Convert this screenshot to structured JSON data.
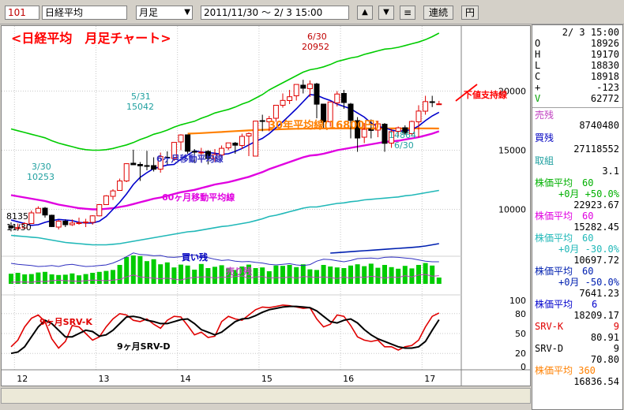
{
  "toolbar": {
    "code": "101",
    "name": "日経平均",
    "period": "月足",
    "dropdown_arrow": "▼",
    "range": "2011/11/30 ～ 2/ 3 15:00",
    "up": "▲",
    "down": "▼",
    "menu": "≡",
    "renzoku": "連続",
    "yen": "円"
  },
  "chart": {
    "title": "<日経平均　月足チャート>",
    "annotations": {
      "high_date": "6/30",
      "high_value": "20952",
      "may_date": "5/31",
      "may_value": "15042",
      "march_date": "3/30",
      "march_value": "10253",
      "start_value": "8135",
      "start_date": "11/30",
      "low_value": "14864",
      "low_date": "6/30",
      "ma30": "30年平均線(16800円)",
      "ma6": "6ヶ月移動平均線",
      "ma60": "60ヶ月移動平均線",
      "support": "下値支持線",
      "buy": "買い残",
      "sell": "売り残",
      "srv_k": "9ヶ月SRV-K",
      "srv_d": "9ヶ月SRV-D"
    },
    "y_ticks": [
      "20000",
      "15000",
      "10000"
    ],
    "osc_ticks": [
      "100",
      "80",
      "50",
      "20",
      "0"
    ],
    "x_ticks": [
      "12",
      "13",
      "14",
      "15",
      "16",
      "17"
    ],
    "colors": {
      "up": "#e00000",
      "down": "#000000",
      "ma6": "#0000cc",
      "ma60": "#e000e0",
      "ma360": "#ff8000",
      "green": "#00cc00",
      "teal": "#20b8b8",
      "navy": "#0020b0",
      "srvk": "#e00000",
      "srvd": "#000000"
    }
  },
  "panel": {
    "datetime": "2/ 3 15:00",
    "ohlc": [
      {
        "k": "O",
        "v": "18926"
      },
      {
        "k": "H",
        "v": "19170"
      },
      {
        "k": "L",
        "v": "18830"
      },
      {
        "k": "C",
        "v": "18918"
      },
      {
        "k": "+",
        "v": "-123"
      },
      {
        "k": "V",
        "v": "62772"
      }
    ],
    "urizan_label": "売残",
    "urizan_value": "8740480",
    "kaizan_label": "買残",
    "kaizan_value": "27118552",
    "torikumi_label": "取組",
    "torikumi_value": "3.1",
    "ma_a_label": "株価平均　60",
    "ma_a_sub": "+0月 +50.0%",
    "ma_a_value": "22923.67",
    "ma_b_label": "株価平均　60",
    "ma_b_value": "15282.45",
    "ma_c_label": "株価平均　60",
    "ma_c_sub": "+0月 -30.0%",
    "ma_c_value": "10697.72",
    "ma_d_label": "株価平均　60",
    "ma_d_sub": "+0月 -50.0%",
    "ma_d_value": "7641.23",
    "ma_e_label": "株価平均　　6",
    "ma_e_value": "18209.17",
    "srvk_label": "SRV-K",
    "srvk_n": "9",
    "srvk_value": "80.91",
    "srvd_label": "SRV-D",
    "srvd_n": "9",
    "srvd_value": "70.80",
    "ma_f_label": "株価平均 360",
    "ma_f_value": "16836.54"
  },
  "chart_data": {
    "type": "candlestick",
    "x": [
      "2011-11",
      "2011-12",
      "2012-01",
      "2012-02",
      "2012-03",
      "2012-04",
      "2012-05",
      "2012-06",
      "2012-07",
      "2012-08",
      "2012-09",
      "2012-10",
      "2012-11",
      "2012-12",
      "2013-01",
      "2013-02",
      "2013-03",
      "2013-04",
      "2013-05",
      "2013-06",
      "2013-07",
      "2013-08",
      "2013-09",
      "2013-10",
      "2013-11",
      "2013-12",
      "2014-01",
      "2014-02",
      "2014-03",
      "2014-04",
      "2014-05",
      "2014-06",
      "2014-07",
      "2014-08",
      "2014-09",
      "2014-10",
      "2014-11",
      "2014-12",
      "2015-01",
      "2015-02",
      "2015-03",
      "2015-04",
      "2015-05",
      "2015-06",
      "2015-07",
      "2015-08",
      "2015-09",
      "2015-10",
      "2015-11",
      "2015-12",
      "2016-01",
      "2016-02",
      "2016-03",
      "2016-04",
      "2016-05",
      "2016-06",
      "2016-07",
      "2016-08",
      "2016-09",
      "2016-10",
      "2016-11",
      "2016-12",
      "2017-01",
      "2017-02"
    ],
    "open": [
      8600,
      8440,
      8430,
      8800,
      9700,
      10100,
      9500,
      8500,
      9000,
      8700,
      8800,
      8900,
      8900,
      9450,
      10400,
      11100,
      11600,
      12400,
      13900,
      13800,
      13700,
      13700,
      13400,
      14400,
      14300,
      15700,
      16300,
      14900,
      14800,
      14900,
      14300,
      14600,
      15200,
      15600,
      15400,
      16200,
      14500,
      17500,
      17400,
      17700,
      18800,
      19200,
      19600,
      20500,
      20200,
      20600,
      18900,
      17400,
      19000,
      19800,
      18900,
      17500,
      16100,
      16800,
      16700,
      17200,
      15600,
      16600,
      16900,
      16400,
      17400,
      18300,
      19100,
      18900
    ],
    "high": [
      8900,
      8800,
      8900,
      9900,
      10255,
      10200,
      9550,
      9100,
      9150,
      9150,
      9300,
      9200,
      9500,
      10450,
      11200,
      11700,
      12600,
      13900,
      15042,
      14000,
      14950,
      14400,
      14800,
      14900,
      15600,
      16350,
      16200,
      15100,
      15200,
      15000,
      15100,
      15400,
      15600,
      15700,
      16400,
      16500,
      17500,
      18000,
      17900,
      18800,
      19800,
      20100,
      20500,
      20952,
      20900,
      20700,
      18900,
      19000,
      20000,
      20100,
      19000,
      17800,
      17300,
      17600,
      17500,
      17300,
      16800,
      17000,
      17100,
      17500,
      18800,
      19600,
      19600,
      19170
    ],
    "low": [
      8135,
      8200,
      8350,
      8800,
      9700,
      9300,
      8500,
      8300,
      8500,
      8600,
      8700,
      8500,
      8700,
      9400,
      10400,
      10800,
      11600,
      12300,
      13800,
      12400,
      13300,
      13200,
      13100,
      13800,
      14100,
      15000,
      14700,
      13900,
      14000,
      13800,
      14000,
      14300,
      15000,
      14700,
      15100,
      14500,
      16400,
      16600,
      16600,
      17400,
      18600,
      18900,
      19200,
      19800,
      19500,
      17700,
      16900,
      17000,
      18700,
      18500,
      16000,
      14865,
      15600,
      16000,
      16100,
      14864,
      15200,
      16200,
      16300,
      16200,
      16100,
      18000,
      18650,
      18830
    ],
    "close": [
      8430,
      8450,
      8800,
      9700,
      10083,
      9520,
      8540,
      9000,
      8700,
      8840,
      8870,
      8930,
      9450,
      10400,
      11140,
      11560,
      12400,
      13860,
      13770,
      13680,
      13670,
      13390,
      14460,
      14330,
      15660,
      16290,
      14910,
      14840,
      14830,
      14300,
      14630,
      15160,
      15620,
      15420,
      16170,
      16410,
      17460,
      17450,
      17670,
      18800,
      19210,
      19520,
      20560,
      20240,
      20590,
      18890,
      17390,
      19080,
      19750,
      19030,
      17520,
      16030,
      16760,
      16670,
      17230,
      15580,
      16570,
      16890,
      16450,
      17430,
      18310,
      19110,
      19040,
      18918
    ],
    "ma6": [
      9100,
      8950,
      8800,
      8650,
      8700,
      8900,
      9050,
      9150,
      9100,
      9050,
      8900,
      8850,
      8850,
      9000,
      9400,
      10000,
      10600,
      11300,
      12100,
      12700,
      13100,
      13450,
      13600,
      13750,
      13800,
      14250,
      14600,
      14950,
      14850,
      14800,
      14750,
      14650,
      14700,
      14900,
      15150,
      15450,
      15750,
      16000,
      16400,
      16900,
      17400,
      17950,
      18500,
      19100,
      19700,
      19650,
      19400,
      19200,
      18900,
      18700,
      18500,
      18150,
      17800,
      17300,
      17000,
      16900,
      16700,
      16600,
      16650,
      16750,
      17050,
      17500,
      17900,
      18209
    ],
    "ma60": [
      11200,
      11100,
      11000,
      10900,
      10800,
      10700,
      10550,
      10400,
      10300,
      10200,
      10100,
      10050,
      10000,
      10000,
      10050,
      10100,
      10200,
      10300,
      10450,
      10600,
      10750,
      10900,
      11000,
      11150,
      11300,
      11450,
      11550,
      11650,
      11800,
      11950,
      12100,
      12200,
      12300,
      12450,
      12600,
      12750,
      12950,
      13150,
      13400,
      13600,
      13800,
      14000,
      14200,
      14400,
      14550,
      14600,
      14700,
      14850,
      15000,
      15100,
      15200,
      15300,
      15400,
      15500,
      15600,
      15700,
      15750,
      15800,
      15900,
      16000,
      16100,
      16250,
      16400,
      16600
    ],
    "ma360": [
      null,
      null,
      null,
      null,
      null,
      null,
      null,
      null,
      null,
      null,
      null,
      null,
      null,
      null,
      null,
      null,
      null,
      null,
      null,
      null,
      null,
      null,
      null,
      null,
      null,
      null,
      16400,
      16420,
      16450,
      16480,
      16510,
      16540,
      16580,
      16610,
      16640,
      16670,
      16700,
      16720,
      16740,
      16760,
      16780,
      16800,
      16810,
      16820,
      16830,
      16840,
      16840,
      16840,
      16840,
      16840,
      16840,
      16840,
      16840,
      16840,
      16840,
      16840,
      16840,
      16840,
      16840,
      16840,
      16840,
      16840,
      16840,
      16836.54
    ],
    "band_plus50": [
      16800,
      16650,
      16500,
      16350,
      16200,
      16050,
      15800,
      15600,
      15450,
      15300,
      15150,
      15050,
      15000,
      15000,
      15050,
      15150,
      15300,
      15450,
      15650,
      15900,
      16100,
      16350,
      16500,
      16700,
      16950,
      17150,
      17300,
      17450,
      17700,
      17900,
      18150,
      18300,
      18450,
      18650,
      18900,
      19100,
      19400,
      19700,
      20100,
      20400,
      20700,
      21000,
      21300,
      21600,
      21800,
      21900,
      22050,
      22250,
      22500,
      22650,
      22800,
      22900,
      23100,
      23250,
      23400,
      23550,
      23600,
      23700,
      23850,
      24000,
      24150,
      24350,
      24600,
      24900
    ],
    "band_minus30": [
      7800,
      7750,
      7700,
      7650,
      7600,
      7500,
      7400,
      7300,
      7200,
      7150,
      7100,
      7050,
      7000,
      7000,
      7000,
      7050,
      7100,
      7200,
      7300,
      7400,
      7500,
      7600,
      7700,
      7800,
      7900,
      8000,
      8100,
      8150,
      8250,
      8350,
      8450,
      8550,
      8600,
      8700,
      8800,
      8900,
      9050,
      9200,
      9400,
      9500,
      9650,
      9800,
      9950,
      10100,
      10200,
      10200,
      10300,
      10400,
      10500,
      10550,
      10650,
      10700,
      10800,
      10850,
      10900,
      10950,
      11000,
      11050,
      11150,
      11200,
      11300,
      11400,
      11500,
      11600
    ],
    "band_minus50": [
      null,
      null,
      null,
      null,
      null,
      null,
      null,
      null,
      null,
      null,
      null,
      null,
      null,
      null,
      null,
      null,
      null,
      null,
      null,
      null,
      null,
      null,
      null,
      null,
      null,
      null,
      null,
      null,
      null,
      null,
      null,
      null,
      null,
      null,
      null,
      null,
      null,
      null,
      null,
      null,
      null,
      null,
      null,
      null,
      null,
      null,
      null,
      6300,
      6340,
      6380,
      6420,
      6460,
      6500,
      6540,
      6580,
      6620,
      6660,
      6700,
      6740,
      6780,
      6830,
      6900,
      7000,
      7100
    ],
    "volume": [
      0.32,
      0.35,
      0.3,
      0.31,
      0.36,
      0.38,
      0.3,
      0.28,
      0.29,
      0.33,
      0.27,
      0.31,
      0.35,
      0.38,
      0.41,
      0.44,
      0.6,
      0.85,
      0.9,
      0.88,
      0.72,
      0.78,
      0.62,
      0.68,
      0.52,
      0.61,
      0.58,
      0.45,
      0.63,
      0.5,
      0.54,
      0.59,
      0.49,
      0.44,
      0.55,
      0.61,
      0.5,
      0.52,
      0.4,
      0.58,
      0.57,
      0.6,
      0.53,
      0.62,
      0.46,
      0.44,
      0.6,
      0.55,
      0.52,
      0.5,
      0.58,
      0.62,
      0.56,
      0.64,
      0.51,
      0.6,
      0.53,
      0.48,
      0.57,
      0.49,
      0.6,
      0.66,
      0.58,
      0.2
    ],
    "kaizan": [
      0.65,
      0.62,
      0.6,
      0.58,
      0.55,
      0.56,
      0.58,
      0.55,
      0.6,
      0.62,
      0.58,
      0.55,
      0.56,
      0.58,
      0.6,
      0.66,
      0.75,
      0.86,
      0.98,
      0.93,
      0.92,
      0.89,
      0.9,
      0.85,
      0.84,
      0.86,
      0.9,
      0.92,
      0.85,
      0.83,
      0.78,
      0.74,
      0.76,
      0.72,
      0.7,
      0.71,
      0.68,
      0.66,
      0.62,
      0.6,
      0.62,
      0.64,
      0.6,
      0.58,
      0.61,
      0.72,
      0.78,
      0.77,
      0.73,
      0.7,
      0.74,
      0.8,
      0.81,
      0.82,
      0.8,
      0.84,
      0.85,
      0.84,
      0.82,
      0.8,
      0.76,
      0.72,
      0.7,
      0.7
    ],
    "urizan": [
      0.05,
      0.06,
      0.06,
      0.05,
      0.08,
      0.07,
      0.1,
      0.12,
      0.1,
      0.09,
      0.08,
      0.1,
      0.12,
      0.11,
      0.1,
      0.12,
      0.14,
      0.22,
      0.28,
      0.22,
      0.2,
      0.18,
      0.16,
      0.18,
      0.15,
      0.12,
      0.18,
      0.2,
      0.22,
      0.22,
      0.18,
      0.22,
      0.2,
      0.23,
      0.25,
      0.18,
      0.22,
      0.23,
      0.18,
      0.2,
      0.19,
      0.22,
      0.18,
      0.23,
      0.22,
      0.2,
      0.22,
      0.2,
      0.17,
      0.22,
      0.18,
      0.22,
      0.2,
      0.24,
      0.22,
      0.18,
      0.22,
      0.2,
      0.26,
      0.22,
      0.28,
      0.3,
      0.24,
      0.26
    ],
    "srv_k": [
      30,
      40,
      60,
      73,
      78,
      68,
      42,
      28,
      38,
      62,
      60,
      50,
      40,
      45,
      60,
      72,
      80,
      78,
      70,
      68,
      72,
      64,
      58,
      70,
      76,
      75,
      62,
      48,
      52,
      44,
      46,
      68,
      76,
      72,
      70,
      78,
      86,
      90,
      89,
      91,
      93,
      92,
      90,
      88,
      89,
      72,
      60,
      64,
      78,
      76,
      62,
      45,
      40,
      38,
      40,
      30,
      30,
      25,
      30,
      32,
      40,
      60,
      76,
      80.91
    ],
    "srv_d": [
      20,
      22,
      30,
      45,
      60,
      70,
      65,
      55,
      45,
      45,
      50,
      55,
      53,
      46,
      48,
      55,
      65,
      75,
      76,
      74,
      70,
      68,
      65,
      65,
      68,
      71,
      72,
      65,
      56,
      52,
      48,
      52,
      60,
      68,
      72,
      73,
      77,
      82,
      86,
      88,
      90,
      91,
      91,
      90,
      89,
      84,
      76,
      68,
      66,
      70,
      72,
      66,
      56,
      48,
      42,
      38,
      34,
      30,
      28,
      28,
      30,
      38,
      55,
      70.8
    ],
    "price_range": [
      6500,
      25500
    ],
    "osc_range": [
      0,
      100
    ],
    "grid": true
  }
}
